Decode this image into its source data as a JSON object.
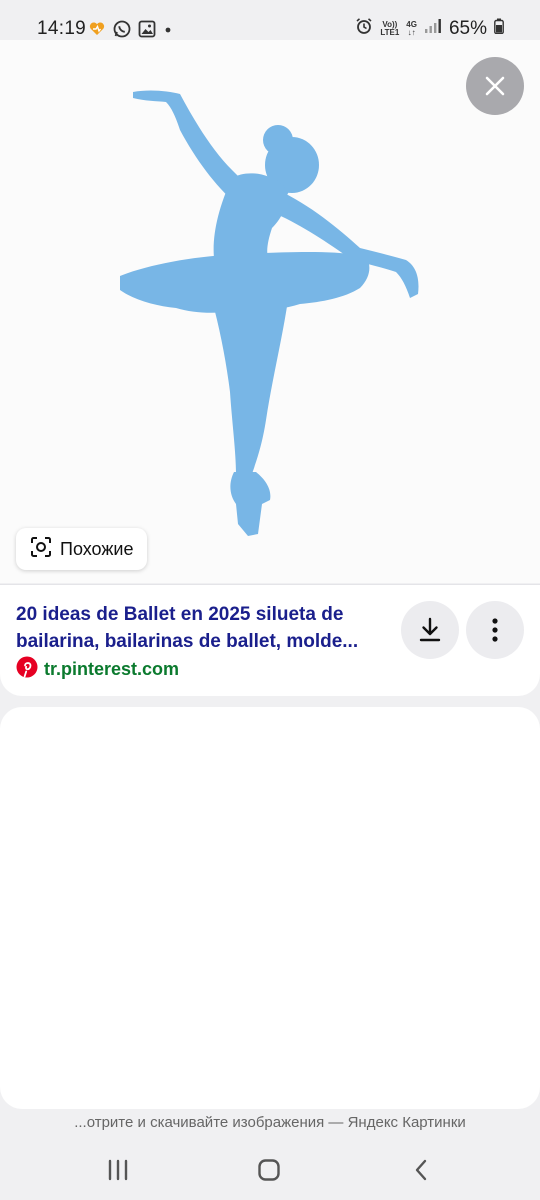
{
  "status_bar": {
    "time": "14:19",
    "network_top": "Vo))",
    "network_bottom": "LTE1",
    "data_top": "4G",
    "data_bottom": "↓↑",
    "battery": "65%"
  },
  "image_viewer": {
    "subject": "ballerina-silhouette",
    "silhouette_color": "#78b6e6",
    "similar_label": "Похожие"
  },
  "result": {
    "title_line1": "20 ideas de Ballet en 2025 silueta de",
    "title_line2": "bailarina, bailarinas de ballet, molde...",
    "source_domain": "tr.pinterest.com",
    "title_color": "#1a1f8c",
    "domain_color": "#0b7a2e",
    "pinterest_color": "#e60023"
  },
  "footer": {
    "caption": "...отрите и скачивайте изображения — Яндекс Картинки"
  }
}
